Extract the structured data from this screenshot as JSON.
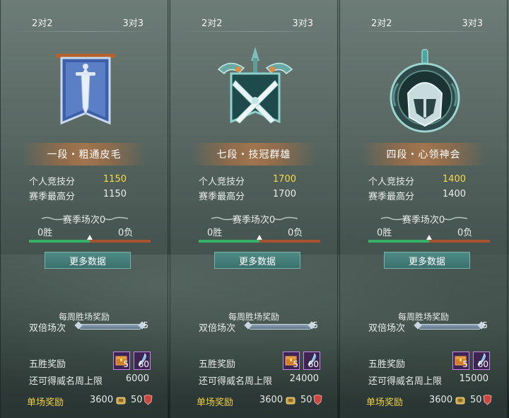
{
  "panels": [
    {
      "tabs": {
        "left": "2对2",
        "right": "3对3"
      },
      "rank_name": "一段・粗通皮毛",
      "emblem_icon": "banner-sword-icon",
      "personal_score_label": "个人竞技分",
      "personal_score": "1150",
      "season_high_label": "赛季最高分",
      "season_high": "1150",
      "season_matches": "赛季场次0",
      "wins": "0胜",
      "losses": "0负",
      "win_ratio": 0.5,
      "more_button": "更多数据",
      "weekly_title": "每周胜场奖励",
      "double_label": "双倍场次",
      "double_count": "5",
      "five_win_label": "五胜奖励",
      "five_win_items": [
        {
          "icon": "chest-icon",
          "count": "5"
        },
        {
          "icon": "quill-icon",
          "count": "60"
        }
      ],
      "limit_label": "还可得威名周上限",
      "limit_value": "6000",
      "single_label": "单场奖励",
      "single_coins": "3600",
      "single_shields": "50"
    },
    {
      "tabs": {
        "left": "2对2",
        "right": "3对3"
      },
      "rank_name": "七段・技冠群雄",
      "emblem_icon": "crossed-swords-crest-icon",
      "personal_score_label": "个人竞技分",
      "personal_score": "1700",
      "season_high_label": "赛季最高分",
      "season_high": "1700",
      "season_matches": "赛季场次0",
      "wins": "0胜",
      "losses": "0负",
      "win_ratio": 0.5,
      "more_button": "更多数据",
      "weekly_title": "每周胜场奖励",
      "double_label": "双倍场次",
      "double_count": "5",
      "five_win_label": "五胜奖励",
      "five_win_items": [
        {
          "icon": "chest-icon",
          "count": "5"
        },
        {
          "icon": "quill-icon",
          "count": "60"
        }
      ],
      "limit_label": "还可得威名周上限",
      "limit_value": "24000",
      "single_label": "单场奖励",
      "single_coins": "3600",
      "single_shields": "50"
    },
    {
      "tabs": {
        "left": "2对2",
        "right": "3对3"
      },
      "rank_name": "四段・心领神会",
      "emblem_icon": "helmet-crest-icon",
      "personal_score_label": "个人竞技分",
      "personal_score": "1400",
      "season_high_label": "赛季最高分",
      "season_high": "1400",
      "season_matches": "赛季场次0",
      "wins": "0胜",
      "losses": "0负",
      "win_ratio": 0.5,
      "more_button": "更多数据",
      "weekly_title": "每周胜场奖励",
      "double_label": "双倍场次",
      "double_count": "5",
      "five_win_label": "五胜奖励",
      "five_win_items": [
        {
          "icon": "chest-icon",
          "count": "5"
        },
        {
          "icon": "quill-icon",
          "count": "60"
        }
      ],
      "limit_label": "还可得威名周上限",
      "limit_value": "15000",
      "single_label": "单场奖励",
      "single_coins": "3600",
      "single_shields": "50"
    }
  ],
  "colors": {
    "score_gold": "#f4d94a",
    "win_green": "#37b06a",
    "loss_red": "#a8532e",
    "button_teal": "#3a716d",
    "single_reward_gold": "#f2d04a"
  }
}
